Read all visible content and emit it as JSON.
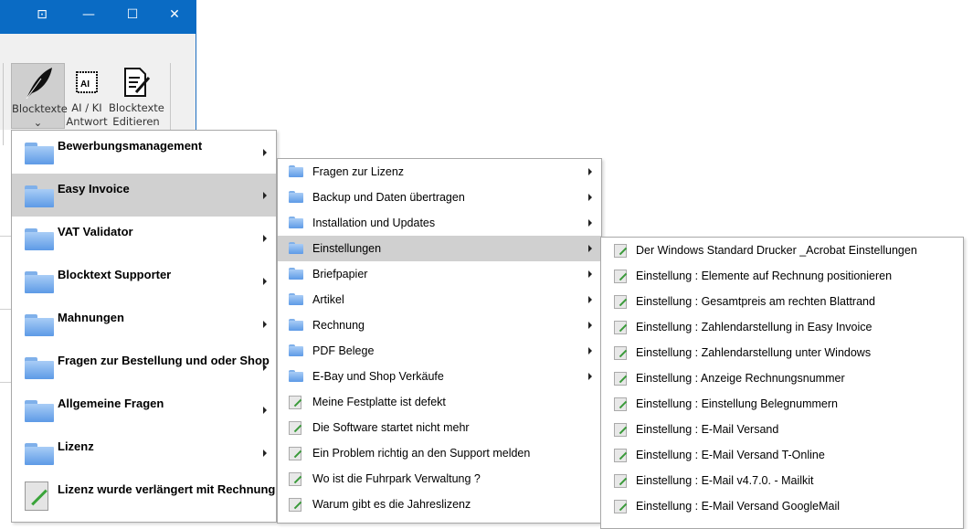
{
  "window": {
    "controls": [
      "restore-to-tray",
      "minimize",
      "maximize",
      "close"
    ]
  },
  "ribbon": {
    "buttons": [
      {
        "label1": "Blocktexte",
        "label2": "⌄",
        "icon": "feather-icon",
        "active": true
      },
      {
        "label1": "AI / KI",
        "label2": "Antwort",
        "icon": "ai-chip-icon"
      },
      {
        "label1": "Blocktexte",
        "label2": "Editieren",
        "icon": "edit-document-icon"
      }
    ]
  },
  "menu1": {
    "items": [
      {
        "label": "Bewerbungsmanagement",
        "type": "folder"
      },
      {
        "label": "Easy Invoice",
        "type": "folder",
        "highlighted": true
      },
      {
        "label": "VAT Validator",
        "type": "folder"
      },
      {
        "label": "Blocktext Supporter",
        "type": "folder"
      },
      {
        "label": "Mahnungen",
        "type": "folder"
      },
      {
        "label": "Fragen zur Bestellung und oder Shop",
        "type": "folder"
      },
      {
        "label": "Allgemeine Fragen",
        "type": "folder"
      },
      {
        "label": "Lizenz",
        "type": "folder"
      },
      {
        "label": "Lizenz wurde verlängert mit Rechnung",
        "type": "document"
      }
    ]
  },
  "menu2": {
    "items": [
      {
        "label": "Fragen zur Lizenz",
        "type": "folder"
      },
      {
        "label": "Backup und Daten übertragen",
        "type": "folder"
      },
      {
        "label": "Installation und Updates",
        "type": "folder"
      },
      {
        "label": "Einstellungen",
        "type": "folder",
        "highlighted": true
      },
      {
        "label": "Briefpapier",
        "type": "folder"
      },
      {
        "label": "Artikel",
        "type": "folder"
      },
      {
        "label": "Rechnung",
        "type": "folder"
      },
      {
        "label": "PDF Belege",
        "type": "folder"
      },
      {
        "label": "E-Bay und Shop Verkäufe",
        "type": "folder"
      },
      {
        "label": "Meine Festplatte ist defekt",
        "type": "document"
      },
      {
        "label": "Die Software startet nicht mehr",
        "type": "document"
      },
      {
        "label": "Ein Problem richtig an den Support melden",
        "type": "document"
      },
      {
        "label": "Wo ist die Fuhrpark Verwaltung ?",
        "type": "document"
      },
      {
        "label": "Warum gibt es die Jahreslizenz",
        "type": "document"
      }
    ]
  },
  "menu3": {
    "items": [
      {
        "label": "Der Windows Standard Drucker _Acrobat Einstellungen"
      },
      {
        "label": "Einstellung : Elemente auf Rechnung positionieren"
      },
      {
        "label": "Einstellung : Gesamtpreis am rechten Blattrand"
      },
      {
        "label": "Einstellung : Zahlendarstellung in Easy Invoice"
      },
      {
        "label": "Einstellung : Zahlendarstellung unter Windows"
      },
      {
        "label": "Einstellung : Anzeige Rechnungsnummer"
      },
      {
        "label": "Einstellung : Einstellung Belegnummern"
      },
      {
        "label": "Einstellung : E-Mail Versand"
      },
      {
        "label": "Einstellung : E-Mail Versand T-Online"
      },
      {
        "label": "Einstellung : E-Mail v4.7.0. - Mailkit"
      },
      {
        "label": "Einstellung : E-Mail Versand GoogleMail"
      }
    ]
  },
  "colors": {
    "titlebar": "#0a6bc4",
    "highlight": "#d0d0d0",
    "ribbon": "#f0f0f0"
  }
}
